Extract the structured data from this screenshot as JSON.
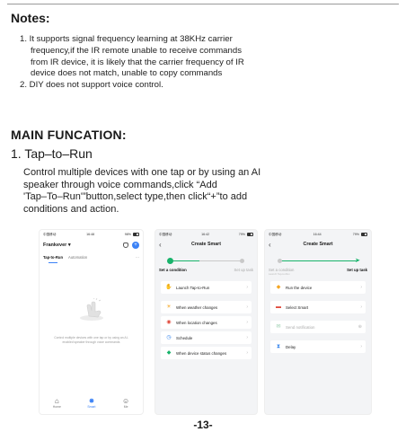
{
  "notes": {
    "title": "Notes:",
    "line1": "1. It supports signal frequency learning at 38KHz carrier",
    "line2": "frequency,if the IR remote unable to receive commands",
    "line3": "from IR device, it is likely that the carrier frequency of IR",
    "line4": "device does not match, unable to copy commands",
    "line5": "2. DIY does not support voice control."
  },
  "main": {
    "title": "MAIN FUNCATION:",
    "section_title": "1. Tap–to–Run",
    "line1": "Control multiple devices with one tap or by using an AI",
    "line2": "speaker through voice commands,click “Add",
    "line3": "'Tap–To–Run'”button,select type,then click“+”to add",
    "line4": "conditions and action."
  },
  "phone1": {
    "status_time": "16:48",
    "carrier": "中国移动",
    "battery": "98%",
    "home_label": "Frankever",
    "tab_tap": "Tap-to-Run",
    "tab_auto": "Automation",
    "more": "···",
    "empty_text": "Control multiple devices with one tap or by using an AI-enabled speaker through voice commands",
    "nav_home": "Home",
    "nav_smart": "Smart",
    "nav_me": "Me"
  },
  "phone2": {
    "status_time": "16:42",
    "carrier": "中国移动",
    "battery": "79%",
    "title": "Create Smart",
    "step1": "Set a condition",
    "step2": "Set up task",
    "items": [
      {
        "icon": "✋",
        "label": "Launch Tap-to-Run"
      },
      {
        "icon": "☀",
        "label": "When weather changes"
      },
      {
        "icon": "◉",
        "label": "When location changes"
      },
      {
        "icon": "◷",
        "label": "Schedule"
      },
      {
        "icon": "◆",
        "label": "When device status changes"
      }
    ]
  },
  "phone3": {
    "status_time": "16:44",
    "carrier": "中国移动",
    "battery": "79%",
    "title": "Create Smart",
    "step1": "Set a condition",
    "step1_sub": "Launch Tap-to-Run",
    "step2": "Set up task",
    "items": [
      {
        "icon": "◆",
        "label": "Run the device"
      },
      {
        "icon": "▬",
        "label": "Select Smart"
      },
      {
        "icon": "✉",
        "label": "Send notification"
      },
      {
        "icon": "⧗",
        "label": "Delay"
      }
    ]
  },
  "page_number": "-13-"
}
